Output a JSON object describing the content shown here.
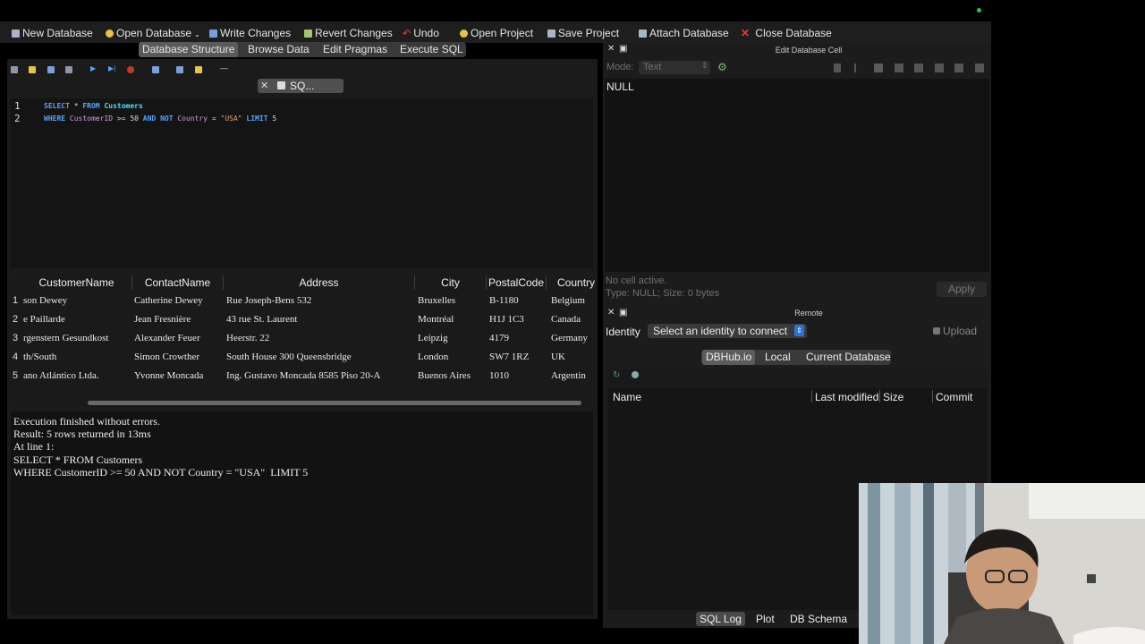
{
  "toolbar": {
    "new_db": "New Database",
    "open_db": "Open Database",
    "write": "Write Changes",
    "revert": "Revert Changes",
    "undo": "Undo",
    "open_project": "Open Project",
    "save_project": "Save Project",
    "attach": "Attach Database",
    "close_db": "Close Database"
  },
  "tabs": [
    "Database Structure",
    "Browse Data",
    "Edit Pragmas",
    "Execute SQL"
  ],
  "active_tab": "Execute SQL",
  "sql_tab": "SQ...",
  "editor": {
    "line_numbers": [
      "1",
      "2"
    ],
    "line1": {
      "kw1": "SELECT",
      "star": " * ",
      "kw2": "FROM",
      "table": " Customers"
    },
    "line2": {
      "kw1": "WHERE",
      "col1": " CustomerID",
      "op": " >= ",
      "num": "50",
      "kw2": " AND NOT",
      "col2": " Country",
      "eq": " = ",
      "str": "\"USA\"",
      "kw3": " LIMIT",
      "limit": " 5"
    }
  },
  "grid": {
    "headers": [
      "CustomerName",
      "ContactName",
      "Address",
      "City",
      "PostalCode",
      "Country"
    ],
    "row_numbers": [
      "1",
      "2",
      "3",
      "4",
      "5"
    ],
    "rows": [
      [
        "son Dewey",
        "Catherine Dewey",
        "Rue Joseph-Bens 532",
        "Bruxelles",
        "B-1180",
        "Belgium"
      ],
      [
        "e Paillarde",
        "Jean Fresnière",
        "43 rue St. Laurent",
        "Montréal",
        "H1J 1C3",
        "Canada"
      ],
      [
        "rgenstern Gesundkost",
        "Alexander Feuer",
        "Heerstr. 22",
        "Leipzig",
        "4179",
        "Germany"
      ],
      [
        "th/South",
        "Simon Crowther",
        "South House 300 Queensbridge",
        "London",
        "SW7 1RZ",
        "UK"
      ],
      [
        "ano Atlántico Ltda.",
        "Yvonne Moncada",
        "Ing. Gustavo Moncada 8585 Piso 20-A",
        "Buenos Aires",
        "1010",
        "Argentin"
      ]
    ]
  },
  "messages": [
    "Execution finished without errors.",
    "Result: 5 rows returned in 13ms",
    "At line 1:",
    "SELECT * FROM Customers",
    "WHERE CustomerID >= 50 AND NOT Country = \"USA\"  LIMIT 5"
  ],
  "edit_cell": {
    "title": "Edit Database Cell",
    "mode_label": "Mode:",
    "mode_value": "Text",
    "cell_value": "NULL",
    "status1": "No cell active.",
    "status2": "Type: NULL; Size: 0 bytes",
    "apply": "Apply"
  },
  "remote": {
    "title": "Remote",
    "identity_label": "Identity",
    "identity_value": "Select an identity to connect",
    "upload": "Upload",
    "subtabs": [
      "DBHub.io",
      "Local",
      "Current Database"
    ],
    "active_subtab": "DBHub.io",
    "columns": [
      "Name",
      "Last modified",
      "Size",
      "Commit"
    ]
  },
  "bottom_tabs": [
    "SQL Log",
    "Plot",
    "DB Schema"
  ],
  "active_bottom_tab": "SQL Log"
}
